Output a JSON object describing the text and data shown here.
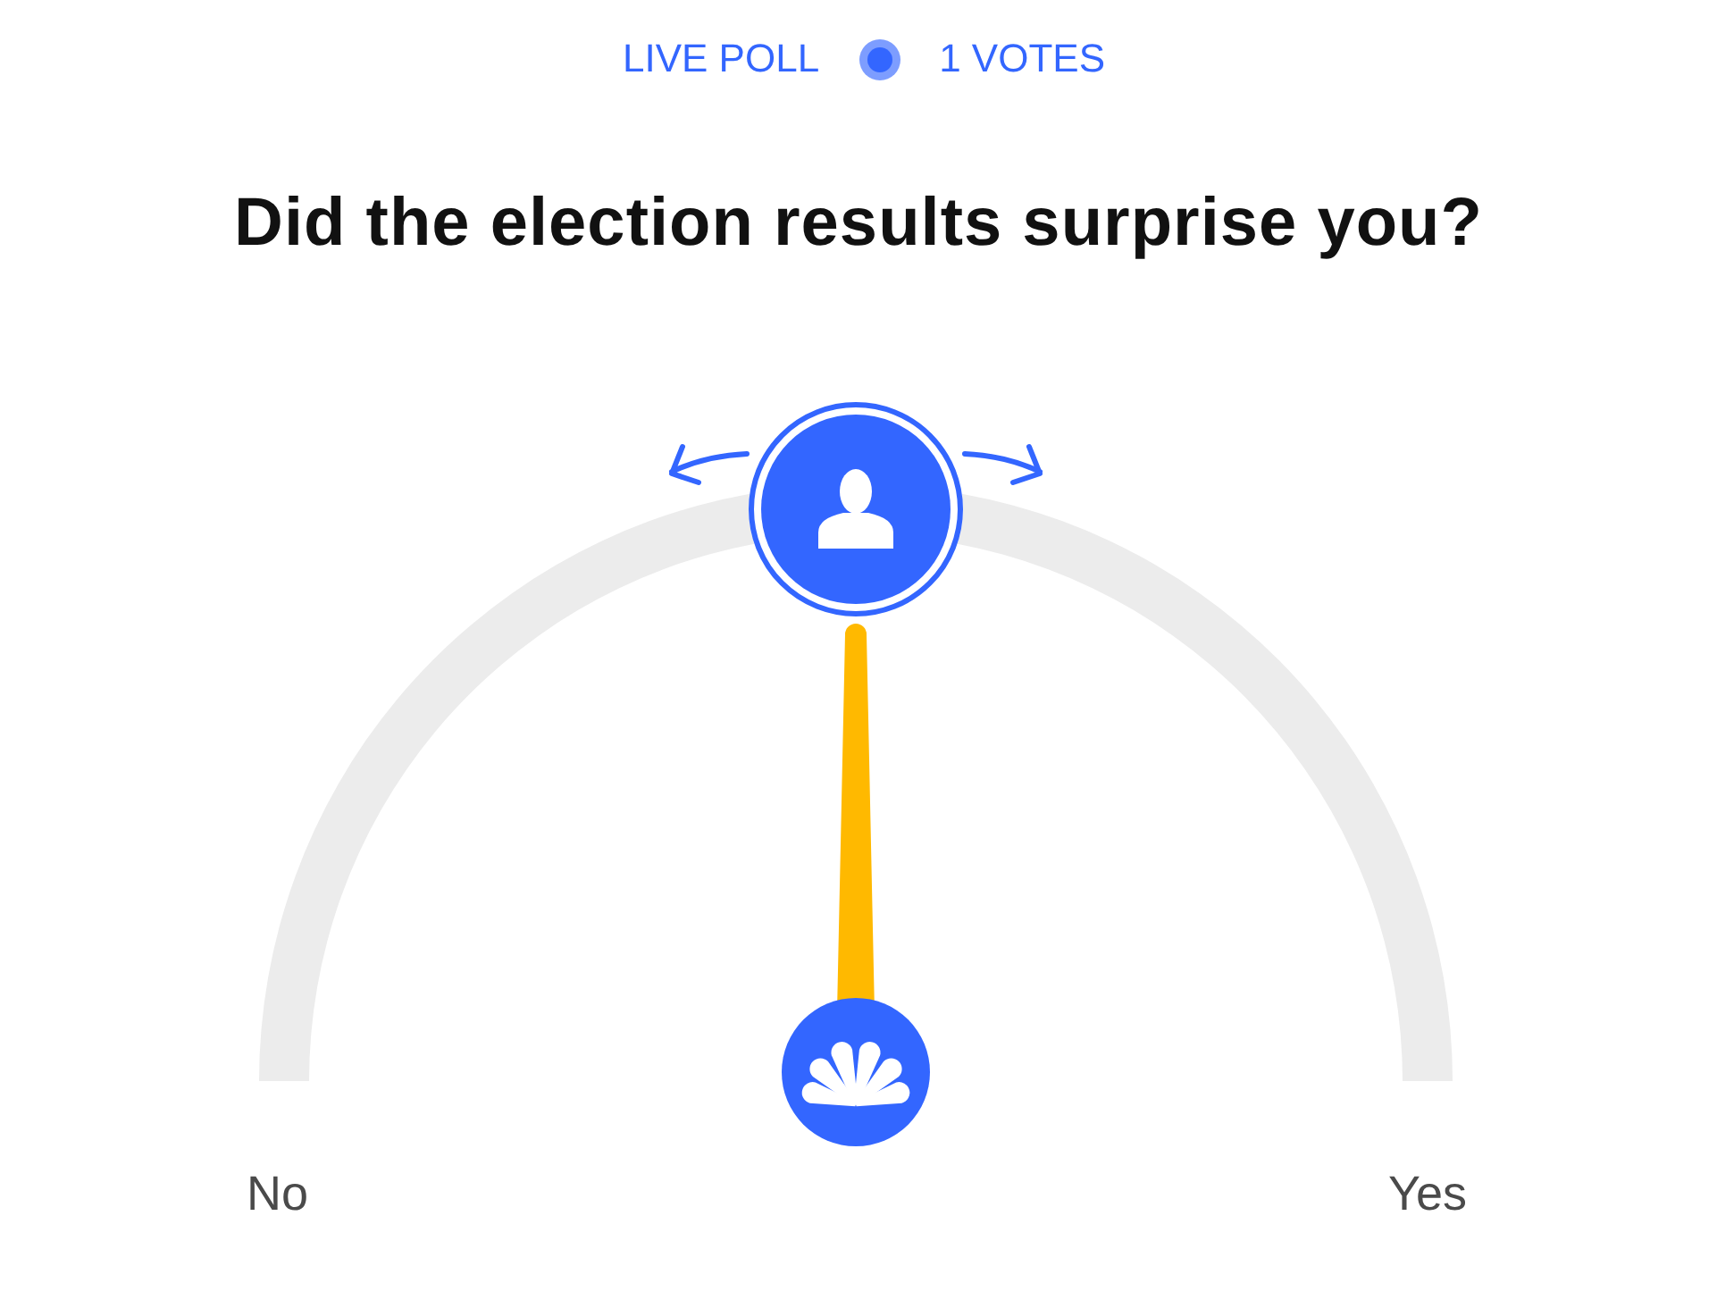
{
  "header": {
    "status": "LIVE POLL",
    "votes": "1 VOTES"
  },
  "question": "Did the election results surprise you?",
  "dial": {
    "level": 0.5,
    "min_label": "No",
    "max_label": "Yes"
  }
}
